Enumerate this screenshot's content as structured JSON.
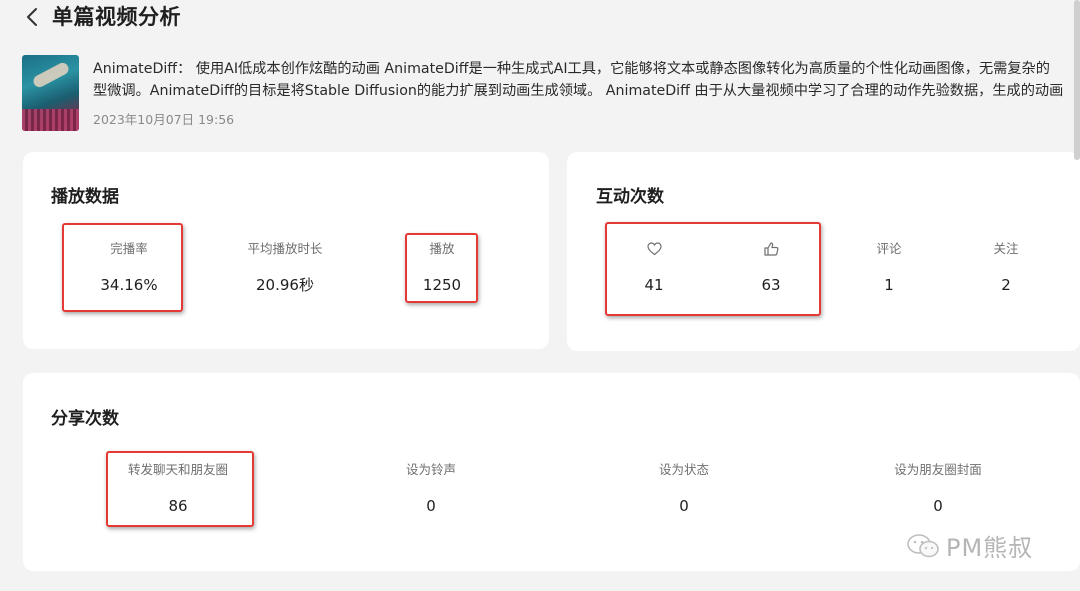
{
  "header": {
    "title": "单篇视频分析"
  },
  "video": {
    "desc_line1": "AnimateDiff： 使用AI低成本创作炫酷的动画 AnimateDiff是一种生成式AI工具，它能够将文本或静态图像转化为高质量的个性化动画图像，无需复杂的",
    "desc_line2": "型微调。AnimateDiff的目标是将Stable Diffusion的能力扩展到动画生成领域。 AnimateDiff 由于从大量视频中学习了合理的动作先验数据，生成的动画",
    "date": "2023年10月07日 19:56"
  },
  "play": {
    "title": "播放数据",
    "completion_label": "完播率",
    "completion_value": "34.16%",
    "avg_label": "平均播放时长",
    "avg_value": "20.96秒",
    "plays_label": "播放",
    "plays_value": "1250"
  },
  "interaction": {
    "title": "互动次数",
    "likes_value": "41",
    "thumbs_value": "63",
    "comments_label": "评论",
    "comments_value": "1",
    "follows_label": "关注",
    "follows_value": "2"
  },
  "share": {
    "title": "分享次数",
    "chat_label": "转发聊天和朋友圈",
    "chat_value": "86",
    "ringtone_label": "设为铃声",
    "ringtone_value": "0",
    "status_label": "设为状态",
    "status_value": "0",
    "moments_label": "设为朋友圈封面",
    "moments_value": "0"
  },
  "watermark": {
    "text": "PM熊叔"
  },
  "colors": {
    "highlight": "#e53935",
    "card": "#ffffff",
    "background": "#f3f3f3"
  }
}
